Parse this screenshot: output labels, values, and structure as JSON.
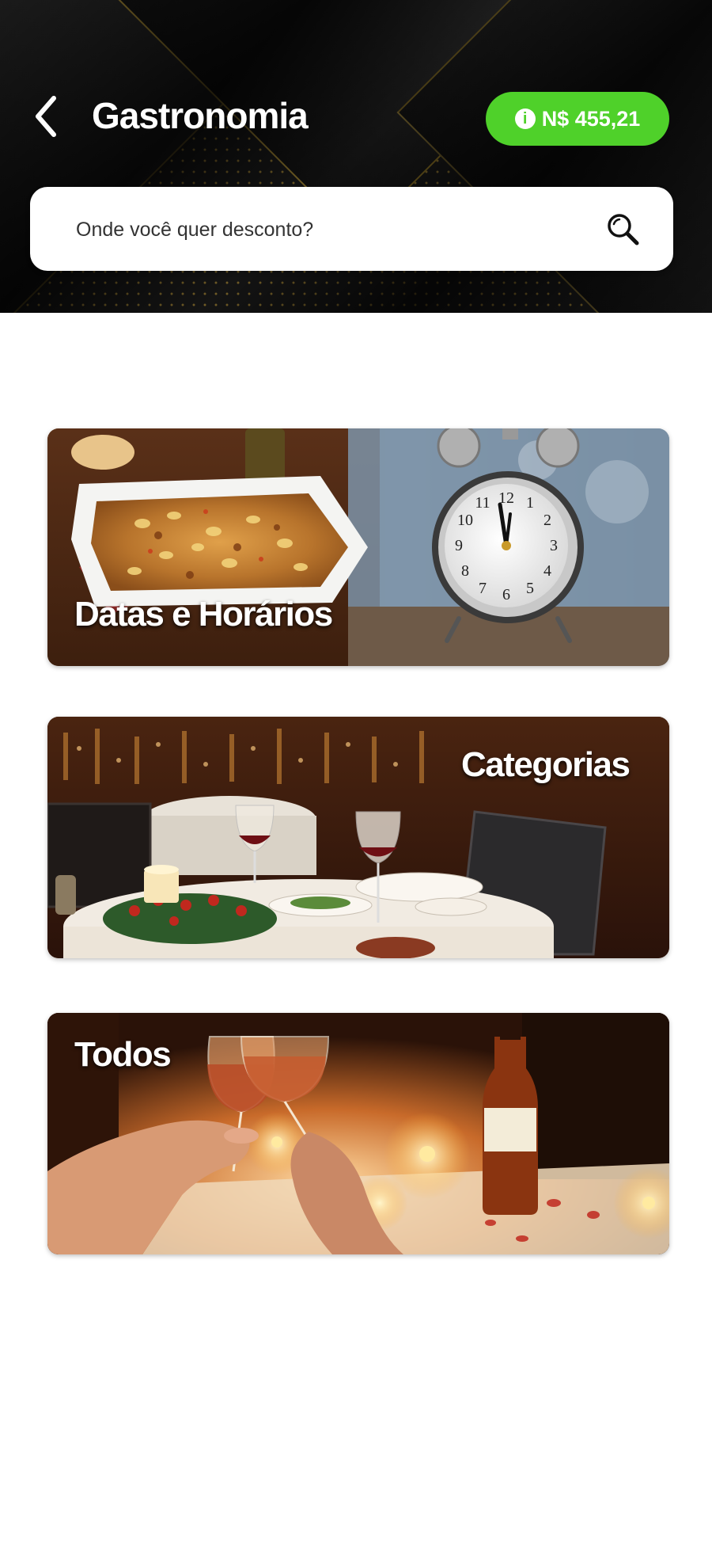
{
  "header": {
    "title": "Gastronomia",
    "balance": "N$ 455,21",
    "balance_color": "#4fd12a",
    "back_icon": "chevron-left-icon",
    "info_icon": "info-icon"
  },
  "search": {
    "placeholder": "Onde você quer desconto?",
    "value": "",
    "icon": "search-icon"
  },
  "cards": [
    {
      "label": "Datas e Horários",
      "image": "casserole-and-alarm-clock"
    },
    {
      "label": "Categorias",
      "image": "restaurant-dining-table"
    },
    {
      "label": "Todos",
      "image": "wine-toast-candlelight"
    }
  ]
}
